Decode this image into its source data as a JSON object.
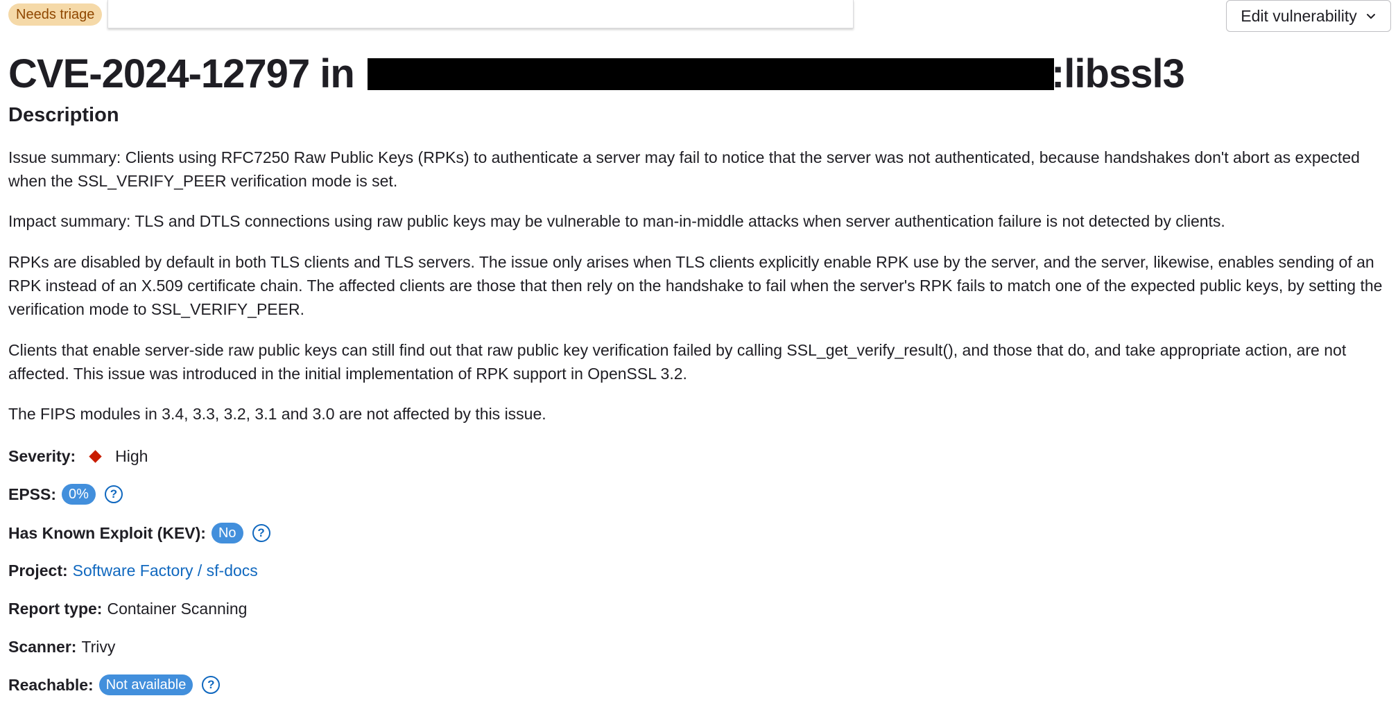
{
  "header": {
    "status_badge": "Needs triage",
    "edit_button_label": "Edit vulnerability"
  },
  "title": {
    "prefix": "CVE-2024-12797 in",
    "suffix": ":libssl3"
  },
  "description": {
    "heading": "Description",
    "paragraphs": [
      "Issue summary: Clients using RFC7250 Raw Public Keys (RPKs) to authenticate a server may fail to notice that the server was not authenticated, because handshakes don't abort as expected when the SSL_VERIFY_PEER verification mode is set.",
      "Impact summary: TLS and DTLS connections using raw public keys may be vulnerable to man-in-middle attacks when server authentication failure is not detected by clients.",
      "RPKs are disabled by default in both TLS clients and TLS servers. The issue only arises when TLS clients explicitly enable RPK use by the server, and the server, likewise, enables sending of an RPK instead of an X.509 certificate chain. The affected clients are those that then rely on the handshake to fail when the server's RPK fails to match one of the expected public keys, by setting the verification mode to SSL_VERIFY_PEER.",
      "Clients that enable server-side raw public keys can still find out that raw public key verification failed by calling SSL_get_verify_result(), and those that do, and take appropriate action, are not affected. This issue was introduced in the initial implementation of RPK support in OpenSSL 3.2.",
      "The FIPS modules in 3.4, 3.3, 3.2, 3.1 and 3.0 are not affected by this issue."
    ]
  },
  "details": {
    "severity": {
      "label": "Severity:",
      "value": "High",
      "color": "#c91c00"
    },
    "epss": {
      "label": "EPSS:",
      "value": "0%"
    },
    "kev": {
      "label": "Has Known Exploit (KEV):",
      "value": "No"
    },
    "project": {
      "label": "Project:",
      "value": "Software Factory / sf-docs"
    },
    "report_type": {
      "label": "Report type:",
      "value": "Container Scanning"
    },
    "scanner": {
      "label": "Scanner:",
      "value": "Trivy"
    },
    "reachable": {
      "label": "Reachable:",
      "value": "Not available"
    }
  },
  "icons": {
    "help": "question-circle-icon",
    "chevron": "chevron-down-icon",
    "severity": "severity-diamond-icon"
  },
  "help_glyph": "?",
  "colors": {
    "link": "#1068bf",
    "pill": "#428fdc",
    "triage_bg": "#f5d9a8",
    "triage_text": "#8f4700"
  }
}
